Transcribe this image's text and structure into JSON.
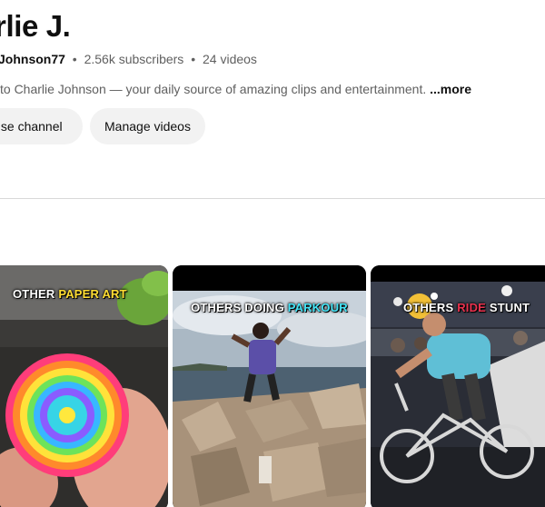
{
  "channel": {
    "name": "rlie J.",
    "handle": "Johnson77",
    "subscribers": "2.56k subscribers",
    "videos": "24 videos",
    "separator": "•",
    "description": "to Charlie Johnson — your daily source of amazing clips and entertainment.",
    "more_label": "...more"
  },
  "actions": {
    "customise_label": "nise channel",
    "manage_label": "Manage videos"
  },
  "shorts": [
    {
      "caption_plain": "OTHER ",
      "caption_highlight": "PAPER ART",
      "highlight_color": "#ffdd33"
    },
    {
      "caption_plain": "OTHERS DOING ",
      "caption_highlight": "PARKOUR",
      "highlight_color": "#45e4f6"
    },
    {
      "caption_plain": "OTHERS ",
      "caption_highlight": "RIDE",
      "caption_tail": " STUNT",
      "highlight_color": "#e8324e"
    }
  ],
  "colors": {
    "text_primary": "#0f0f0f",
    "text_secondary": "#606060",
    "pill_bg": "#f2f2f2",
    "divider": "#d9d9d9"
  }
}
